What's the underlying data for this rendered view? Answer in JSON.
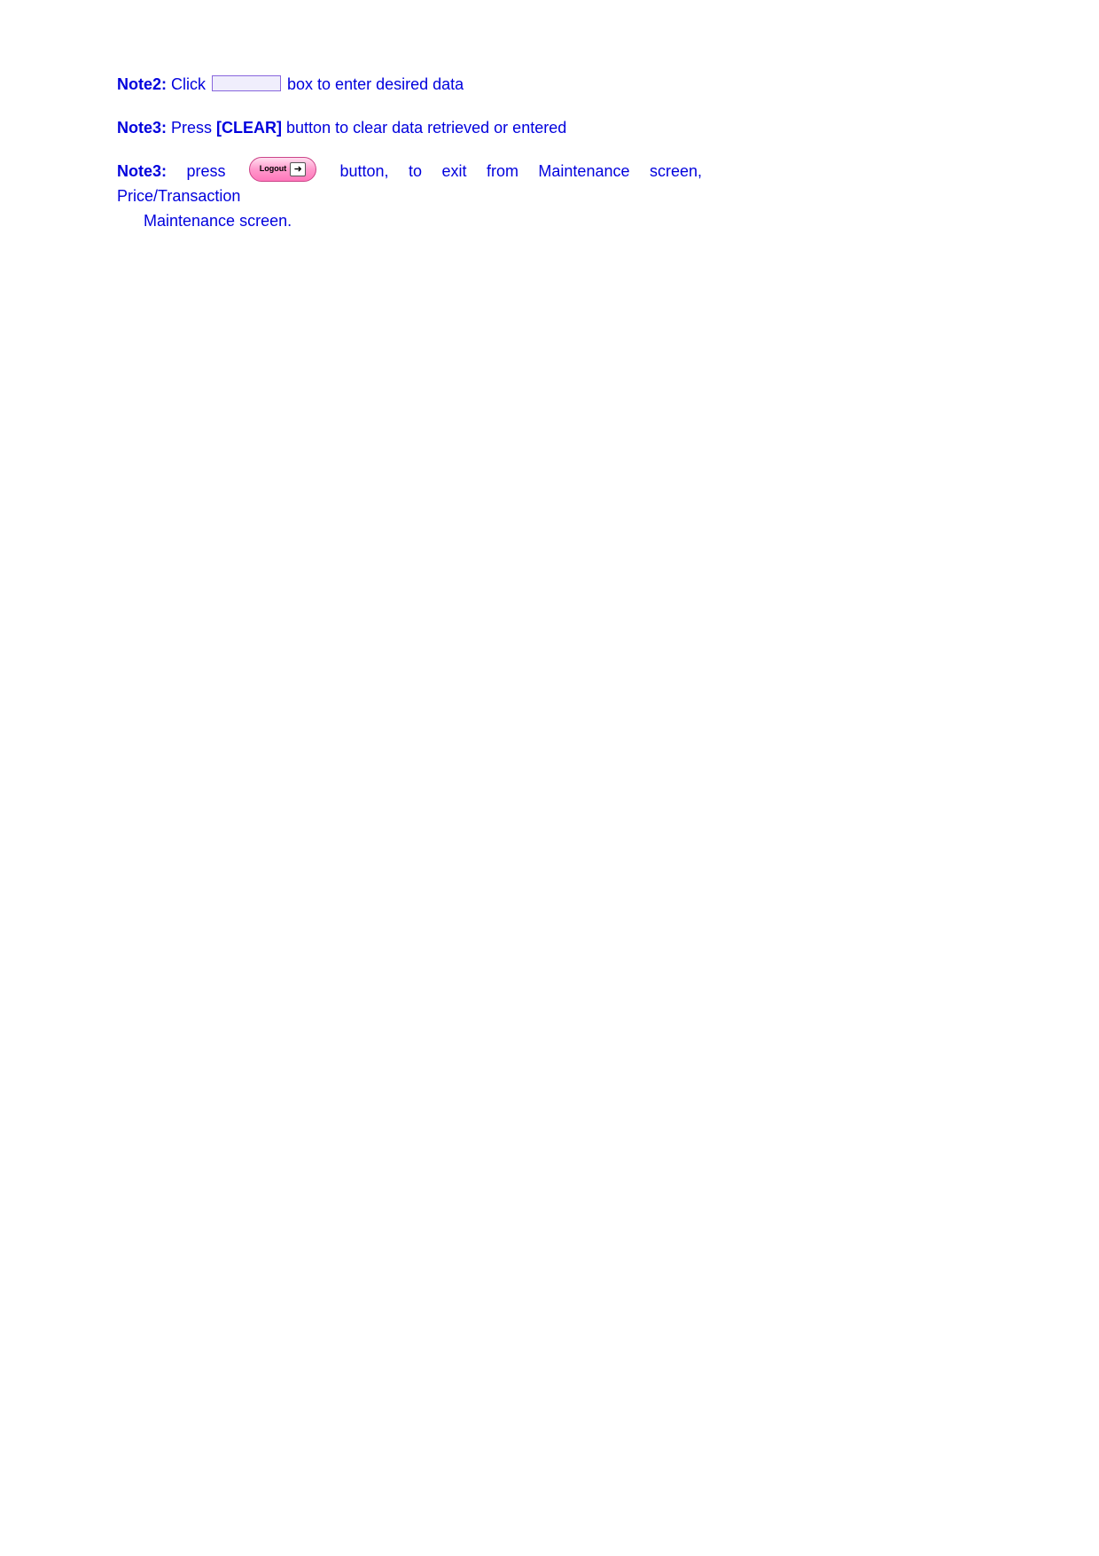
{
  "notes": {
    "note2": {
      "label": "Note2:",
      "before": " Click ",
      "after": " box to enter desired data"
    },
    "note3a": {
      "label": "Note3:",
      "before": " Press ",
      "bold": "[CLEAR]",
      "after": " button to clear data retrieved or entered"
    },
    "note3b": {
      "label": "Note3:",
      "before": " press ",
      "logout_label": "Logout",
      "after1": " button, to exit from Maintenance screen, Price/Transaction",
      "line2": "Maintenance screen."
    }
  }
}
